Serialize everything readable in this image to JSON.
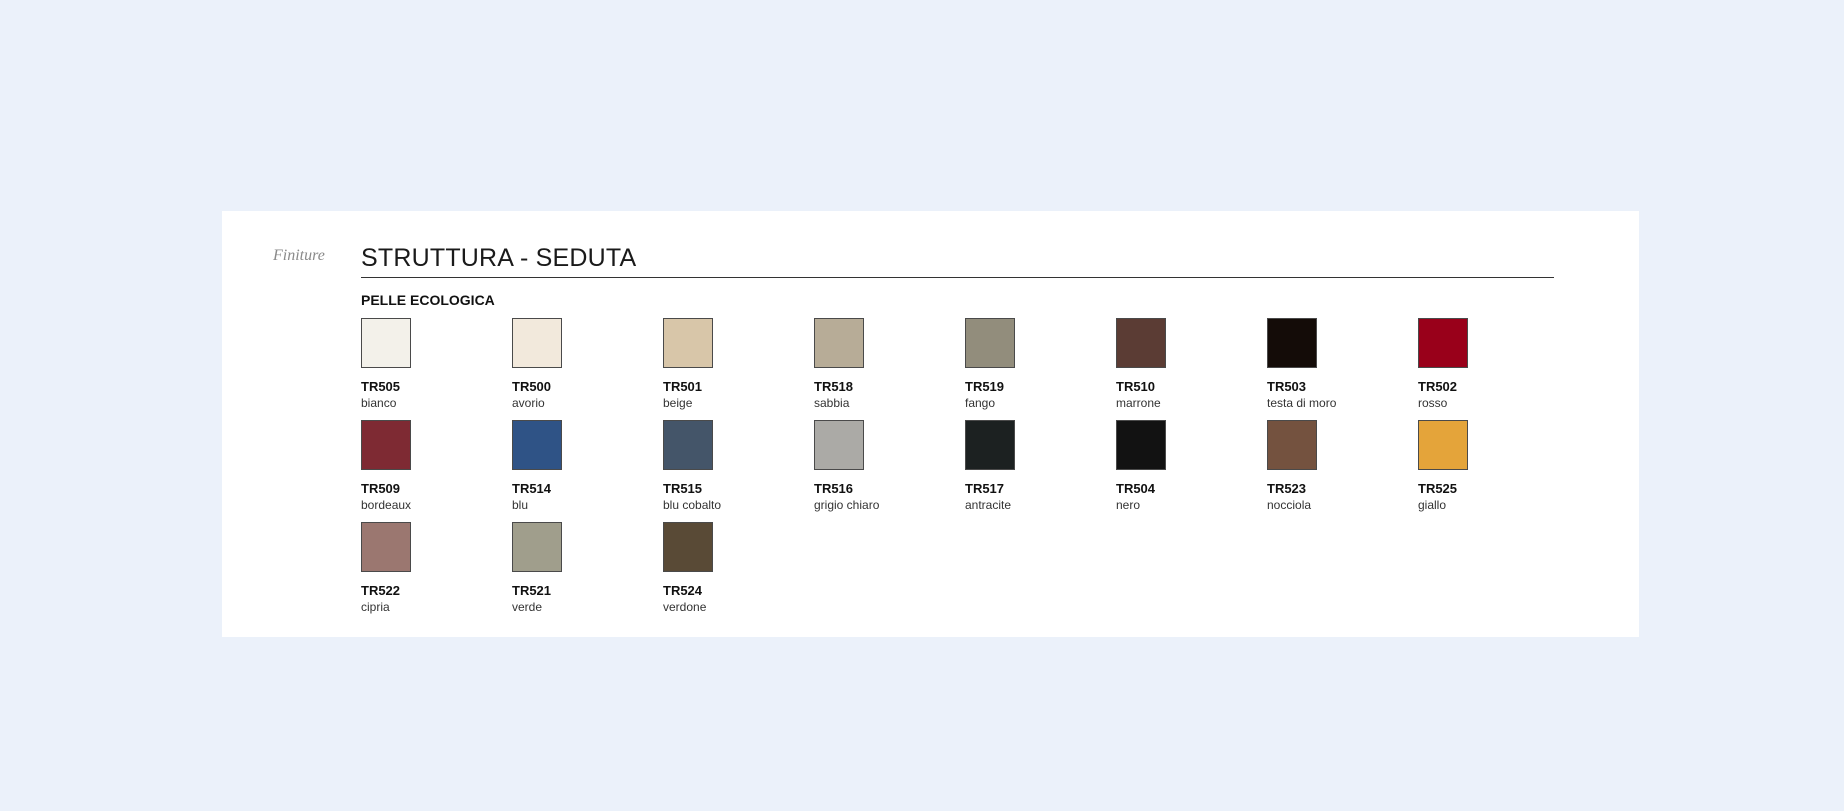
{
  "section_label": "Finiture",
  "title": "STRUTTURA - SEDUTA",
  "subtitle": "PELLE ECOLOGICA",
  "swatches": [
    {
      "code": "TR505",
      "name": "bianco",
      "color": "#f3f1ea"
    },
    {
      "code": "TR500",
      "name": "avorio",
      "color": "#f2e9dc"
    },
    {
      "code": "TR501",
      "name": "beige",
      "color": "#d8c6a9"
    },
    {
      "code": "TR518",
      "name": "sabbia",
      "color": "#b7ac97"
    },
    {
      "code": "TR519",
      "name": "fango",
      "color": "#928d7c"
    },
    {
      "code": "TR510",
      "name": "marrone",
      "color": "#5b3c34"
    },
    {
      "code": "TR503",
      "name": "testa di moro",
      "color": "#140c08"
    },
    {
      "code": "TR502",
      "name": "rosso",
      "color": "#99001a"
    },
    {
      "code": "TR509",
      "name": "bordeaux",
      "color": "#7e2a33"
    },
    {
      "code": "TR514",
      "name": "blu",
      "color": "#2f5386"
    },
    {
      "code": "TR515",
      "name": "blu cobalto",
      "color": "#445569"
    },
    {
      "code": "TR516",
      "name": "grigio chiaro",
      "color": "#abaaa6"
    },
    {
      "code": "TR517",
      "name": "antracite",
      "color": "#1c2121"
    },
    {
      "code": "TR504",
      "name": "nero",
      "color": "#121212"
    },
    {
      "code": "TR523",
      "name": "nocciola",
      "color": "#74523f"
    },
    {
      "code": "TR525",
      "name": "giallo",
      "color": "#e4a43a"
    },
    {
      "code": "TR522",
      "name": "cipria",
      "color": "#9b7770"
    },
    {
      "code": "TR521",
      "name": "verde",
      "color": "#a09e8c"
    },
    {
      "code": "TR524",
      "name": "verdone",
      "color": "#594a36"
    }
  ]
}
